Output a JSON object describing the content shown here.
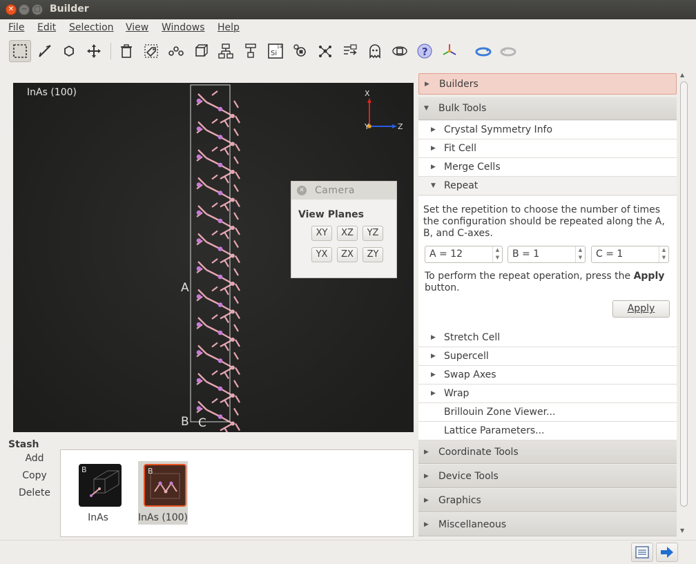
{
  "window": {
    "title": "Builder"
  },
  "menu": [
    "File",
    "Edit",
    "Selection",
    "View",
    "Windows",
    "Help"
  ],
  "toolbar": {
    "tools": [
      "select-tool-icon",
      "measure-tool-icon",
      "hexagon-tool-icon",
      "move-tool-icon",
      "delete-icon",
      "tag-icon",
      "molecule-chain-icon",
      "cube-icon",
      "tree-down-icon",
      "tree-icon",
      "si-element-icon",
      "atom-icon",
      "network-icon",
      "export-arrow-icon",
      "ghost-icon",
      "cube-rotate-icon",
      "help-icon",
      "axes-icon",
      "undo-ring-icon",
      "redo-ring-icon"
    ],
    "si_label": "Si",
    "si_number": "14"
  },
  "viewport": {
    "label": "InAs (100)",
    "axis_a": "A",
    "axis_b": "B",
    "axis_c": "C",
    "triad_x": "X",
    "triad_y": "Y",
    "triad_z": "Z"
  },
  "camera": {
    "title": "Camera",
    "close_symbol": "✕",
    "section": "View Planes",
    "buttons": [
      "XY",
      "XZ",
      "YZ",
      "YX",
      "ZX",
      "ZY"
    ]
  },
  "stash": {
    "title": "Stash",
    "actions": [
      "Add",
      "Copy",
      "Delete"
    ],
    "items": [
      {
        "label": "InAs",
        "badge": "B"
      },
      {
        "label": "InAs (100)",
        "badge": "B"
      }
    ]
  },
  "panel": {
    "builders": "Builders",
    "bulk_tools": "Bulk Tools",
    "bulk_items": [
      "Crystal Symmetry Info",
      "Fit Cell",
      "Merge Cells"
    ],
    "repeat": "Repeat",
    "repeat_desc": "Set the repetition to choose the number of times the configuration should be repeated along the A, B, and C-axes.",
    "spin_a": "A = 12",
    "spin_b": "B = 1",
    "spin_c": "C = 1",
    "perform_pre": "To perform the repeat operation, press the ",
    "perform_bold": "Apply",
    "perform_post": " button.",
    "apply": "Apply",
    "more_items": [
      "Stretch Cell",
      "Supercell",
      "Swap Axes",
      "Wrap"
    ],
    "plain_items": [
      "Brillouin Zone Viewer...",
      "Lattice Parameters..."
    ],
    "sections": [
      "Coordinate Tools",
      "Device Tools",
      "Graphics",
      "Miscellaneous"
    ]
  },
  "colors": {
    "accent": "#e95420",
    "builders_bg": "#f3d2c9",
    "viewport_bg": "#1e1e1e",
    "atom_in": "#c77ad8",
    "atom_as": "#e7a7b2"
  },
  "statusbar": {
    "buttons": [
      "log-icon",
      "arrow-right-icon"
    ]
  }
}
